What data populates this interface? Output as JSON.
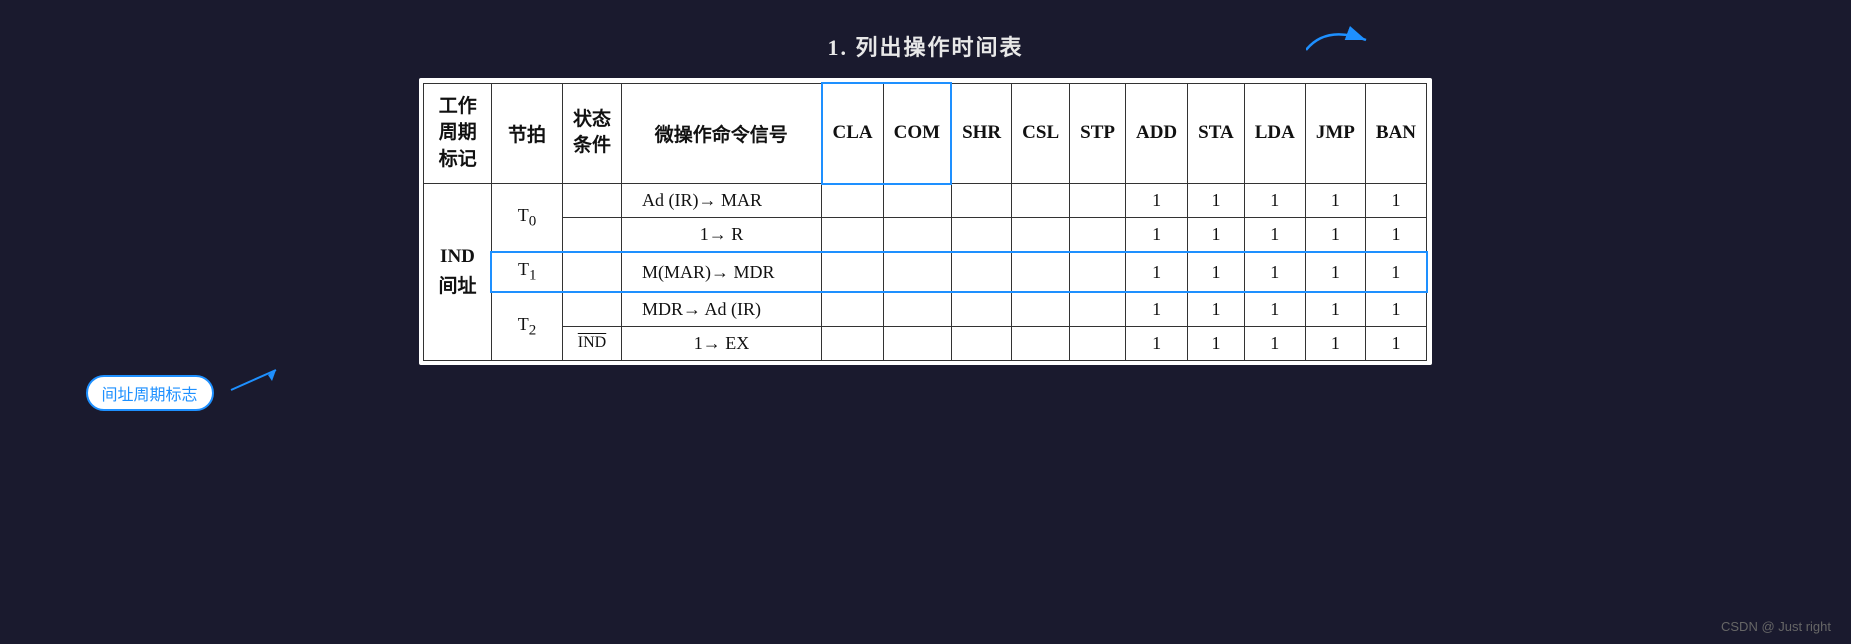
{
  "title": "1.  列出操作时间表",
  "table": {
    "headers": {
      "col1": "工作\n周期\n标记",
      "col2": "节拍",
      "col3": "状态\n条件",
      "col4": "微操作命令信号",
      "col5": "CLA",
      "col6": "COM",
      "col7": "SHR",
      "col8": "CSL",
      "col9": "STP",
      "col10": "ADD",
      "col11": "STA",
      "col12": "LDA",
      "col13": "JMP",
      "col14": "BAN"
    },
    "rows": [
      {
        "cycle": "IND\n间址",
        "beat": "T₀",
        "condition": "",
        "signal": "Ad (IR)→ MAR",
        "CLA": "",
        "COM": "",
        "SHR": "",
        "CSL": "",
        "STP": "",
        "ADD": "1",
        "STA": "1",
        "LDA": "1",
        "JMP": "1",
        "BAN": "1",
        "rowspan_cycle": 5,
        "rowspan_beat": 2
      },
      {
        "cycle": "",
        "beat": "",
        "condition": "",
        "signal": "1→ R",
        "CLA": "",
        "COM": "",
        "SHR": "",
        "CSL": "",
        "STP": "",
        "ADD": "1",
        "STA": "1",
        "LDA": "1",
        "JMP": "1",
        "BAN": "1"
      },
      {
        "cycle": "",
        "beat": "T₁",
        "condition": "",
        "signal": "M(MAR)→ MDR",
        "CLA": "",
        "COM": "",
        "SHR": "",
        "CSL": "",
        "STP": "",
        "ADD": "1",
        "STA": "1",
        "LDA": "1",
        "JMP": "1",
        "BAN": "1",
        "highlight_row": true
      },
      {
        "cycle": "",
        "beat": "T₂",
        "condition": "",
        "signal": "MDR→ Ad (IR)",
        "CLA": "",
        "COM": "",
        "SHR": "",
        "CSL": "",
        "STP": "",
        "ADD": "1",
        "STA": "1",
        "LDA": "1",
        "JMP": "1",
        "BAN": "1",
        "rowspan_beat": 2
      },
      {
        "cycle": "",
        "beat": "",
        "condition": "IND_overline",
        "signal": "1→ EX",
        "CLA": "",
        "COM": "",
        "SHR": "",
        "CSL": "",
        "STP": "",
        "ADD": "1",
        "STA": "1",
        "LDA": "1",
        "JMP": "1",
        "BAN": "1"
      }
    ]
  },
  "annotation": "间址周期标志",
  "watermark": "CSDN @        Just right"
}
